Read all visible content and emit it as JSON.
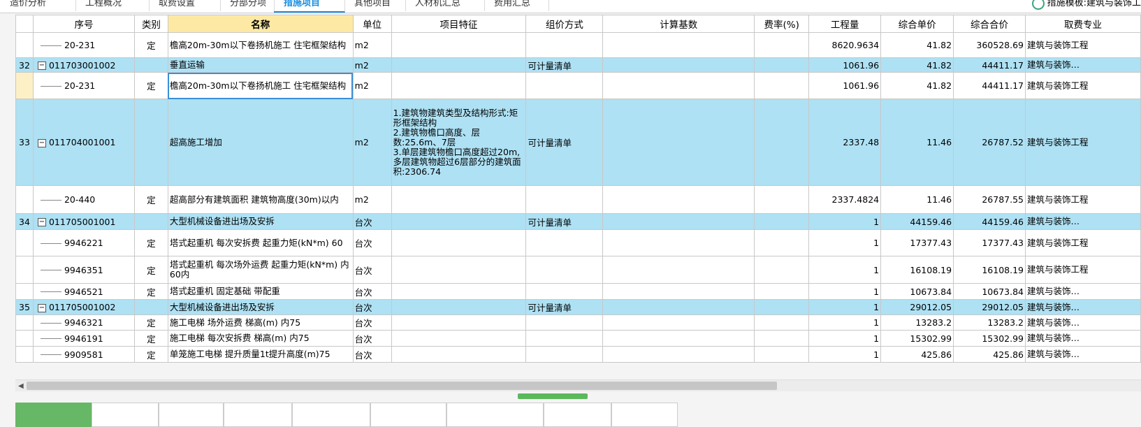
{
  "top_tabs": [
    {
      "label": "造价分析",
      "active": false
    },
    {
      "label": "工程概况",
      "active": false
    },
    {
      "label": "取费设置",
      "active": false
    },
    {
      "label": "分部分项",
      "active": false
    },
    {
      "label": "措施项目",
      "active": true
    },
    {
      "label": "其他项目",
      "active": false
    },
    {
      "label": "人材机汇总",
      "active": false
    },
    {
      "label": "费用汇总",
      "active": false
    }
  ],
  "top_right_text": "措施模板:建筑与装饰工",
  "columns": [
    "",
    "序号",
    "类别",
    "名称",
    "单位",
    "项目特征",
    "组价方式",
    "计算基数",
    "费率(%)",
    "工程量",
    "综合单价",
    "综合合价",
    "取费专业"
  ],
  "rows": [
    {
      "idx": "",
      "code": "20-231",
      "type": "定",
      "name": "檐高20m-30m以下卷扬机施工 住宅框架结构",
      "unit": "m2",
      "feature": "",
      "method": "",
      "base": "",
      "rate": "",
      "qty": "8620.9634",
      "price": "41.82",
      "total": "360528.69",
      "major": "建筑与装饰工程",
      "kind": "sub"
    },
    {
      "idx": "32",
      "code": "011703001002",
      "type": "",
      "name": "垂直运输",
      "unit": "m2",
      "feature": "",
      "method": "可计量清单",
      "base": "",
      "rate": "",
      "qty": "1061.96",
      "price": "41.82",
      "total": "44411.17",
      "major": "建筑与装饰…",
      "kind": "list"
    },
    {
      "idx": "",
      "code": "20-231",
      "type": "定",
      "name": "檐高20m-30m以下卷扬机施工 住宅框架结构",
      "unit": "m2",
      "feature": "",
      "method": "",
      "base": "",
      "rate": "",
      "qty": "1061.96",
      "price": "41.82",
      "total": "44411.17",
      "major": "建筑与装饰工程",
      "kind": "sub",
      "selected": true
    },
    {
      "idx": "33",
      "code": "011704001001",
      "type": "",
      "name": "超高施工增加",
      "unit": "m2",
      "feature": "1.建筑物建筑类型及结构形式:矩形框架结构\n2.建筑物檐口高度、层数:25.6m、7层\n3.单层建筑物檐口高度超过20m,多层建筑物超过6层部分的建筑面积:2306.74",
      "method": "可计量清单",
      "base": "",
      "rate": "",
      "qty": "2337.48",
      "price": "11.46",
      "total": "26787.52",
      "major": "建筑与装饰工程",
      "kind": "list"
    },
    {
      "idx": "",
      "code": "20-440",
      "type": "定",
      "name": "超高部分有建筑面积 建筑物高度(30m)以内",
      "unit": "m2",
      "feature": "",
      "method": "",
      "base": "",
      "rate": "",
      "qty": "2337.4824",
      "price": "11.46",
      "total": "26787.55",
      "major": "建筑与装饰工程",
      "kind": "sub"
    },
    {
      "idx": "34",
      "code": "011705001001",
      "type": "",
      "name": "大型机械设备进出场及安拆",
      "unit": "台次",
      "feature": "",
      "method": "可计量清单",
      "base": "",
      "rate": "",
      "qty": "1",
      "price": "44159.46",
      "total": "44159.46",
      "major": "建筑与装饰…",
      "kind": "list"
    },
    {
      "idx": "",
      "code": "9946221",
      "type": "定",
      "name": "塔式起重机 每次安拆费 起重力矩(kN*m) 60",
      "unit": "台次",
      "feature": "",
      "method": "",
      "base": "",
      "rate": "",
      "qty": "1",
      "price": "17377.43",
      "total": "17377.43",
      "major": "建筑与装饰工程",
      "kind": "sub"
    },
    {
      "idx": "",
      "code": "9946351",
      "type": "定",
      "name": "塔式起重机 每次场外运费 起重力矩(kN*m) 内60内",
      "unit": "台次",
      "feature": "",
      "method": "",
      "base": "",
      "rate": "",
      "qty": "1",
      "price": "16108.19",
      "total": "16108.19",
      "major": "建筑与装饰工程",
      "kind": "sub"
    },
    {
      "idx": "",
      "code": "9946521",
      "type": "定",
      "name": "塔式起重机 固定基础 带配重",
      "unit": "台次",
      "feature": "",
      "method": "",
      "base": "",
      "rate": "",
      "qty": "1",
      "price": "10673.84",
      "total": "10673.84",
      "major": "建筑与装饰…",
      "kind": "sub"
    },
    {
      "idx": "35",
      "code": "011705001002",
      "type": "",
      "name": "大型机械设备进出场及安拆",
      "unit": "台次",
      "feature": "",
      "method": "可计量清单",
      "base": "",
      "rate": "",
      "qty": "1",
      "price": "29012.05",
      "total": "29012.05",
      "major": "建筑与装饰…",
      "kind": "list"
    },
    {
      "idx": "",
      "code": "9946321",
      "type": "定",
      "name": "施工电梯 场外运费 梯高(m) 内75",
      "unit": "台次",
      "feature": "",
      "method": "",
      "base": "",
      "rate": "",
      "qty": "1",
      "price": "13283.2",
      "total": "13283.2",
      "major": "建筑与装饰…",
      "kind": "sub"
    },
    {
      "idx": "",
      "code": "9946191",
      "type": "定",
      "name": "施工电梯 每次安拆费 梯高(m) 内75",
      "unit": "台次",
      "feature": "",
      "method": "",
      "base": "",
      "rate": "",
      "qty": "1",
      "price": "15302.99",
      "total": "15302.99",
      "major": "建筑与装饰…",
      "kind": "sub"
    },
    {
      "idx": "",
      "code": "9909581",
      "type": "定",
      "name": "单笼施工电梯 提升质量1t提升高度(m)75",
      "unit": "台次",
      "feature": "",
      "method": "",
      "base": "",
      "rate": "",
      "qty": "1",
      "price": "425.86",
      "total": "425.86",
      "major": "建筑与装饰…",
      "kind": "sub"
    }
  ],
  "expand_symbol": "−",
  "scroll_left_arrow": "◀",
  "bottom_tabs": [
    {
      "label": "",
      "active": true
    },
    {
      "label": "",
      "active": false
    },
    {
      "label": "",
      "active": false
    },
    {
      "label": "",
      "active": false
    },
    {
      "label": "",
      "active": false
    },
    {
      "label": "",
      "active": false
    },
    {
      "label": "",
      "active": false
    },
    {
      "label": "",
      "active": false
    },
    {
      "label": "",
      "active": false
    }
  ]
}
